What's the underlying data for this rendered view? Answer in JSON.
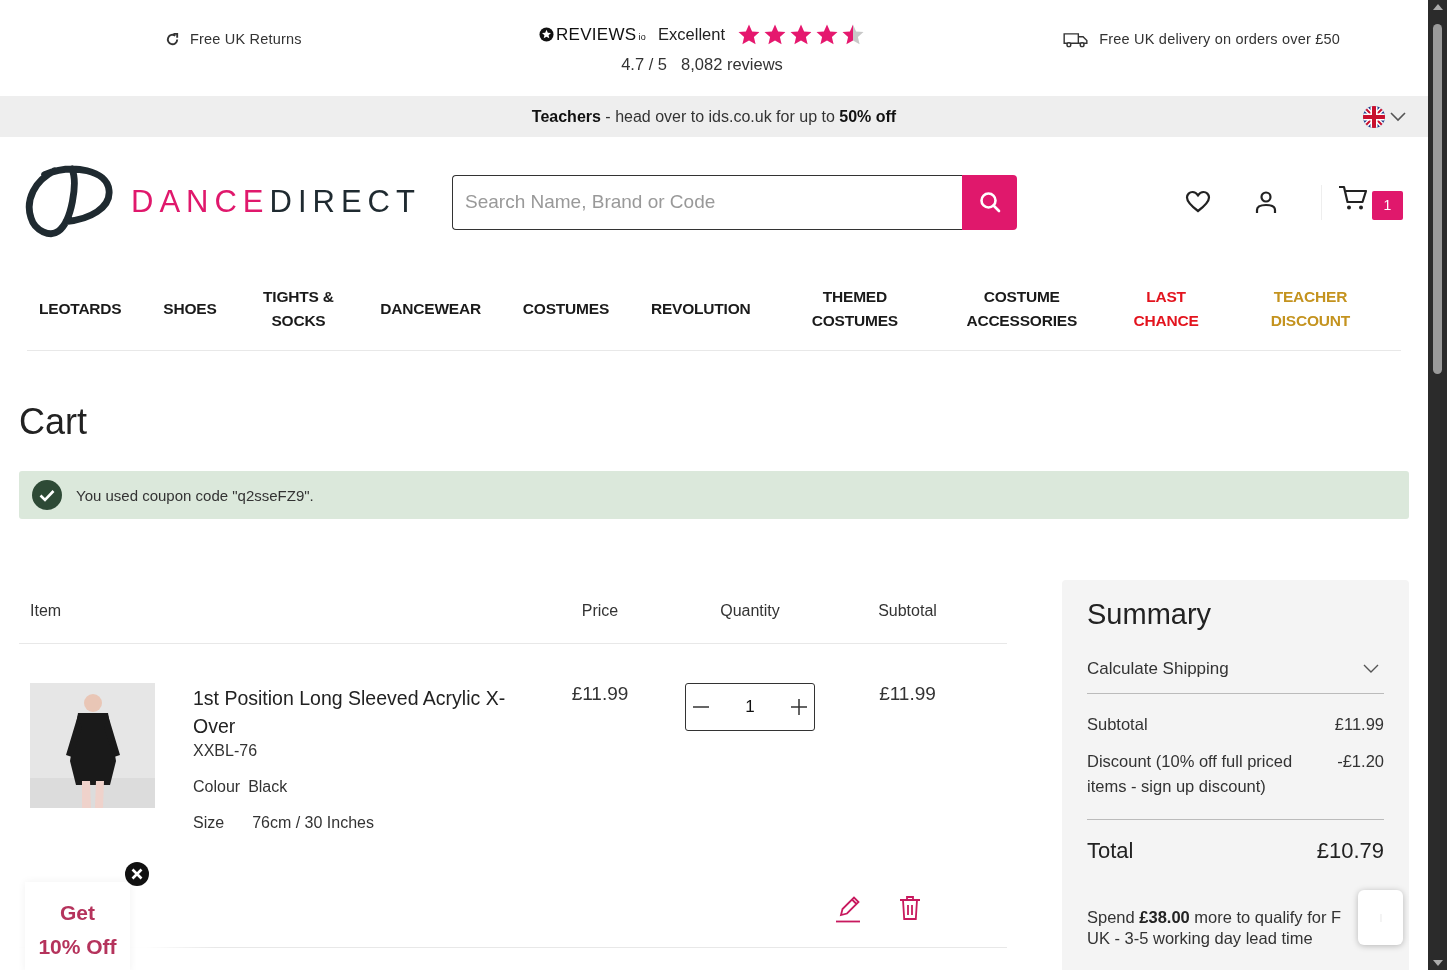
{
  "top_bar": {
    "returns": "Free UK Returns",
    "reviews": {
      "brand": "REVIEWS",
      "brand_suffix": "io",
      "rating_word": "Excellent",
      "stars": 4.5,
      "score": "4.7 / 5",
      "count": "8,082 reviews"
    },
    "delivery": "Free UK delivery on orders over £50"
  },
  "promo_bar": {
    "text": "**Teachers** - head over to ids.co.uk for up to **50% off**"
  },
  "header": {
    "logo_first": "DANCE",
    "logo_second": "DIRECT",
    "search": {
      "placeholder": "Search Name, Brand or Code"
    },
    "cart_count": "1"
  },
  "nav": [
    {
      "label": "LEOTARDS",
      "color": "#1a1a1a"
    },
    {
      "label": "SHOES",
      "color": "#1a1a1a"
    },
    {
      "label": "TIGHTS & SOCKS",
      "color": "#1a1a1a"
    },
    {
      "label": "DANCEWEAR",
      "color": "#1a1a1a"
    },
    {
      "label": "COSTUMES",
      "color": "#1a1a1a"
    },
    {
      "label": "REVOLUTION",
      "color": "#1a1a1a"
    },
    {
      "label": "THEMED COSTUMES",
      "color": "#1a1a1a"
    },
    {
      "label": "COSTUME ACCESSORIES",
      "color": "#1a1a1a"
    },
    {
      "label": "LAST CHANCE",
      "color": "#e3141e"
    },
    {
      "label": "TEACHER DISCOUNT",
      "color": "#c4931f"
    }
  ],
  "page_title": "Cart",
  "notice": {
    "text": "You used coupon code \"q2sseFZ9\"."
  },
  "table": {
    "columns": [
      "Item",
      "Price",
      "Quantity",
      "Subtotal"
    ],
    "rows": [
      {
        "name": "1st Position Long Sleeved Acrylic X-Over",
        "code": "XXBL-76",
        "options": [
          {
            "label": "Colour",
            "value": "Black"
          },
          {
            "label": "Size",
            "value": "76cm / 30 Inches"
          }
        ],
        "price": "£11.99",
        "quantity": "1",
        "subtotal": "£11.99"
      }
    ]
  },
  "summary": {
    "title": "Summary",
    "shipping": {
      "label": "Calculate Shipping",
      "expanded": false
    },
    "lines": [
      {
        "label": "Subtotal",
        "value": "£11.99"
      },
      {
        "label": "Discount (10% off full priced items - sign up discount)",
        "value": "-£1.20"
      }
    ],
    "total": {
      "label": "Total",
      "value": "£10.79"
    },
    "free_delivery": "Spend **£38.00** more to qualify for F",
    "lead_time": "UK - 3-5 working day lead time"
  },
  "popup": {
    "line1": "Get",
    "line2": "10% Off"
  }
}
